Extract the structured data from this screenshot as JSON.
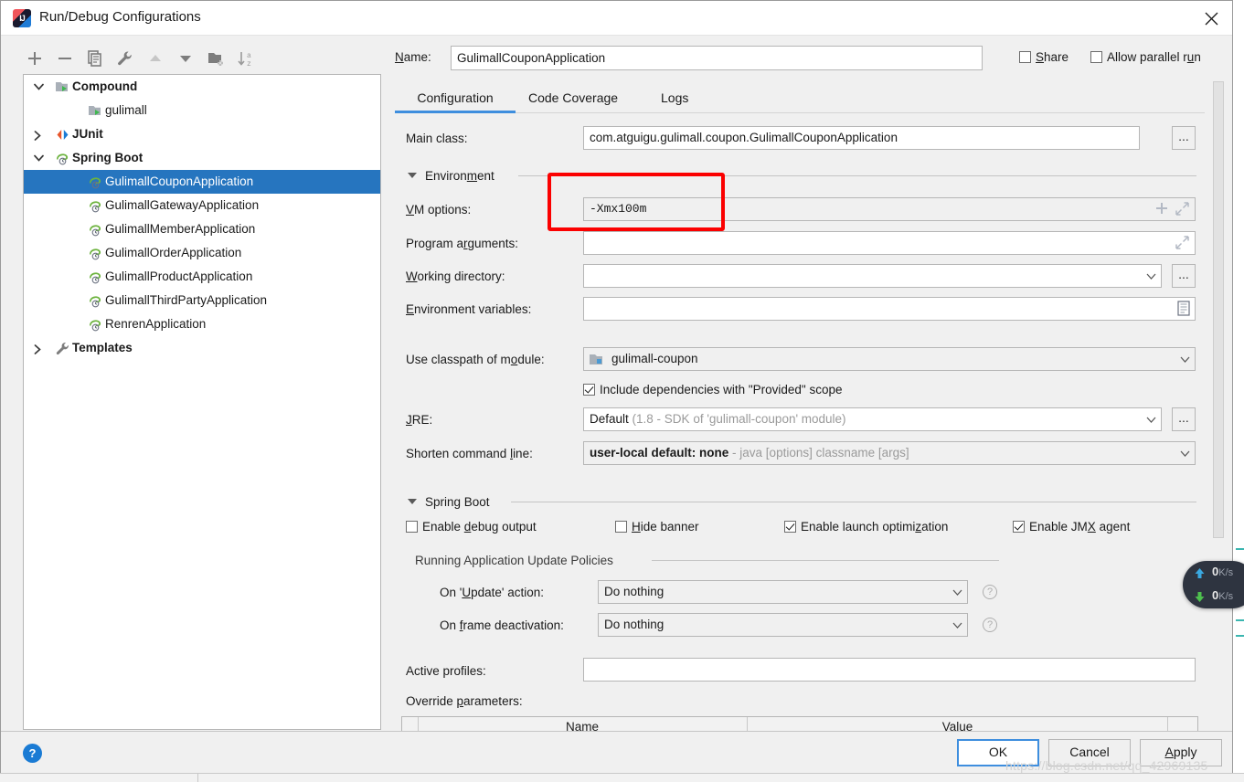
{
  "window": {
    "title": "Run/Debug Configurations",
    "app_icon": "intellij-idea-icon",
    "close_icon": "close-icon"
  },
  "tree_toolbar": {
    "items": [
      {
        "icon": "plus-icon",
        "name": "add-configuration-button"
      },
      {
        "icon": "minus-icon",
        "name": "remove-configuration-button"
      },
      {
        "icon": "copy-icon",
        "name": "copy-configuration-button"
      },
      {
        "icon": "wrench-icon",
        "name": "edit-templates-button"
      },
      {
        "icon": "arrow-up-icon",
        "name": "move-up-button"
      },
      {
        "icon": "arrow-down-icon",
        "name": "move-down-button"
      },
      {
        "icon": "new-folder-icon",
        "name": "create-folder-button"
      },
      {
        "icon": "sort-alpha-icon",
        "name": "sort-configurations-button"
      }
    ]
  },
  "tree": {
    "rows": [
      {
        "label": "Compound",
        "indent": 0,
        "twisty": "expanded",
        "icon": "folder-run-icon",
        "bold": true,
        "selected": false
      },
      {
        "label": "gulimall",
        "indent": 1,
        "twisty": "none",
        "icon": "folder-run-icon",
        "bold": false,
        "selected": false
      },
      {
        "label": "JUnit",
        "indent": 0,
        "twisty": "collapsed",
        "icon": "junit-icon",
        "bold": true,
        "selected": false
      },
      {
        "label": "Spring Boot",
        "indent": 0,
        "twisty": "expanded",
        "icon": "spring-boot-icon",
        "bold": true,
        "selected": false
      },
      {
        "label": "GulimallCouponApplication",
        "indent": 1,
        "twisty": "none",
        "icon": "spring-boot-icon",
        "bold": false,
        "selected": true
      },
      {
        "label": "GulimallGatewayApplication",
        "indent": 1,
        "twisty": "none",
        "icon": "spring-boot-icon",
        "bold": false,
        "selected": false
      },
      {
        "label": "GulimallMemberApplication",
        "indent": 1,
        "twisty": "none",
        "icon": "spring-boot-icon",
        "bold": false,
        "selected": false
      },
      {
        "label": "GulimallOrderApplication",
        "indent": 1,
        "twisty": "none",
        "icon": "spring-boot-icon",
        "bold": false,
        "selected": false
      },
      {
        "label": "GulimallProductApplication",
        "indent": 1,
        "twisty": "none",
        "icon": "spring-boot-icon",
        "bold": false,
        "selected": false
      },
      {
        "label": "GulimallThirdPartyApplication",
        "indent": 1,
        "twisty": "none",
        "icon": "spring-boot-icon",
        "bold": false,
        "selected": false
      },
      {
        "label": "RenrenApplication",
        "indent": 1,
        "twisty": "none",
        "icon": "spring-boot-icon",
        "bold": false,
        "selected": false
      },
      {
        "label": "Templates",
        "indent": 0,
        "twisty": "collapsed",
        "icon": "wrench-icon",
        "bold": true,
        "selected": false
      }
    ]
  },
  "header": {
    "name_label": "Name:",
    "name_value": "GulimallCouponApplication",
    "share_label": "Share",
    "share_checked": false,
    "parallel_label": "Allow parallel run",
    "parallel_checked": false
  },
  "tabs": [
    {
      "label": "Configuration",
      "active": true
    },
    {
      "label": "Code Coverage",
      "active": false
    },
    {
      "label": "Logs",
      "active": false
    }
  ],
  "form": {
    "main_class_label": "Main class:",
    "main_class_value": "com.atguigu.gulimall.coupon.GulimallCouponApplication",
    "environment_section": "Environment",
    "vm_options_label": "VM options:",
    "vm_options_value": "-Xmx100m",
    "program_args_label": "Program arguments:",
    "program_args_value": "",
    "working_dir_label": "Working directory:",
    "working_dir_value": "",
    "env_vars_label": "Environment variables:",
    "env_vars_value": "",
    "classpath_label": "Use classpath of module:",
    "classpath_value": "gulimall-coupon",
    "include_provided_label": "Include dependencies with \"Provided\" scope",
    "include_provided_checked": true,
    "jre_label": "JRE:",
    "jre_value": "Default",
    "jre_hint": "(1.8 - SDK of 'gulimall-coupon' module)",
    "shorten_label": "Shorten command line:",
    "shorten_value": "user-local default: none",
    "shorten_hint": "- java [options] classname [args]",
    "ellipsis_label": "..."
  },
  "spring_boot": {
    "section_title": "Spring Boot",
    "checks": [
      {
        "label": "Enable debug output",
        "checked": false
      },
      {
        "label": "Hide banner",
        "checked": false
      },
      {
        "label": "Enable launch optimization",
        "checked": true
      },
      {
        "label": "Enable JMX agent",
        "checked": true
      }
    ],
    "policies_title": "Running Application Update Policies",
    "update_action_label": "On 'Update' action:",
    "update_action_value": "Do nothing",
    "frame_deactivation_label": "On frame deactivation:",
    "frame_deactivation_value": "Do nothing",
    "help_glyph": "?",
    "active_profiles_label": "Active profiles:",
    "active_profiles_value": "",
    "override_params_label": "Override parameters:",
    "override_table": {
      "columns": [
        "Name",
        "Value"
      ],
      "rows": []
    }
  },
  "footer": {
    "help_label": "?",
    "buttons": [
      {
        "label": "OK",
        "default": true,
        "mnemonic": ""
      },
      {
        "label": "Cancel",
        "default": false,
        "mnemonic": ""
      },
      {
        "label": "Apply",
        "default": false,
        "mnemonic": "A"
      }
    ]
  },
  "net_widget": {
    "upload": {
      "value": "0",
      "unit": "K/s",
      "icon": "arrow-up-icon",
      "color": "#3aa8e0"
    },
    "download": {
      "value": "0",
      "unit": "K/s",
      "icon": "arrow-down-icon",
      "color": "#4ec04e"
    }
  },
  "watermark": "https://blog.csdn.net/qq_42969135",
  "colors": {
    "selection": "#2675bf",
    "accent": "#3e8ede",
    "annotation": "#fb0000",
    "dialog_bg": "#f0f0f0"
  }
}
